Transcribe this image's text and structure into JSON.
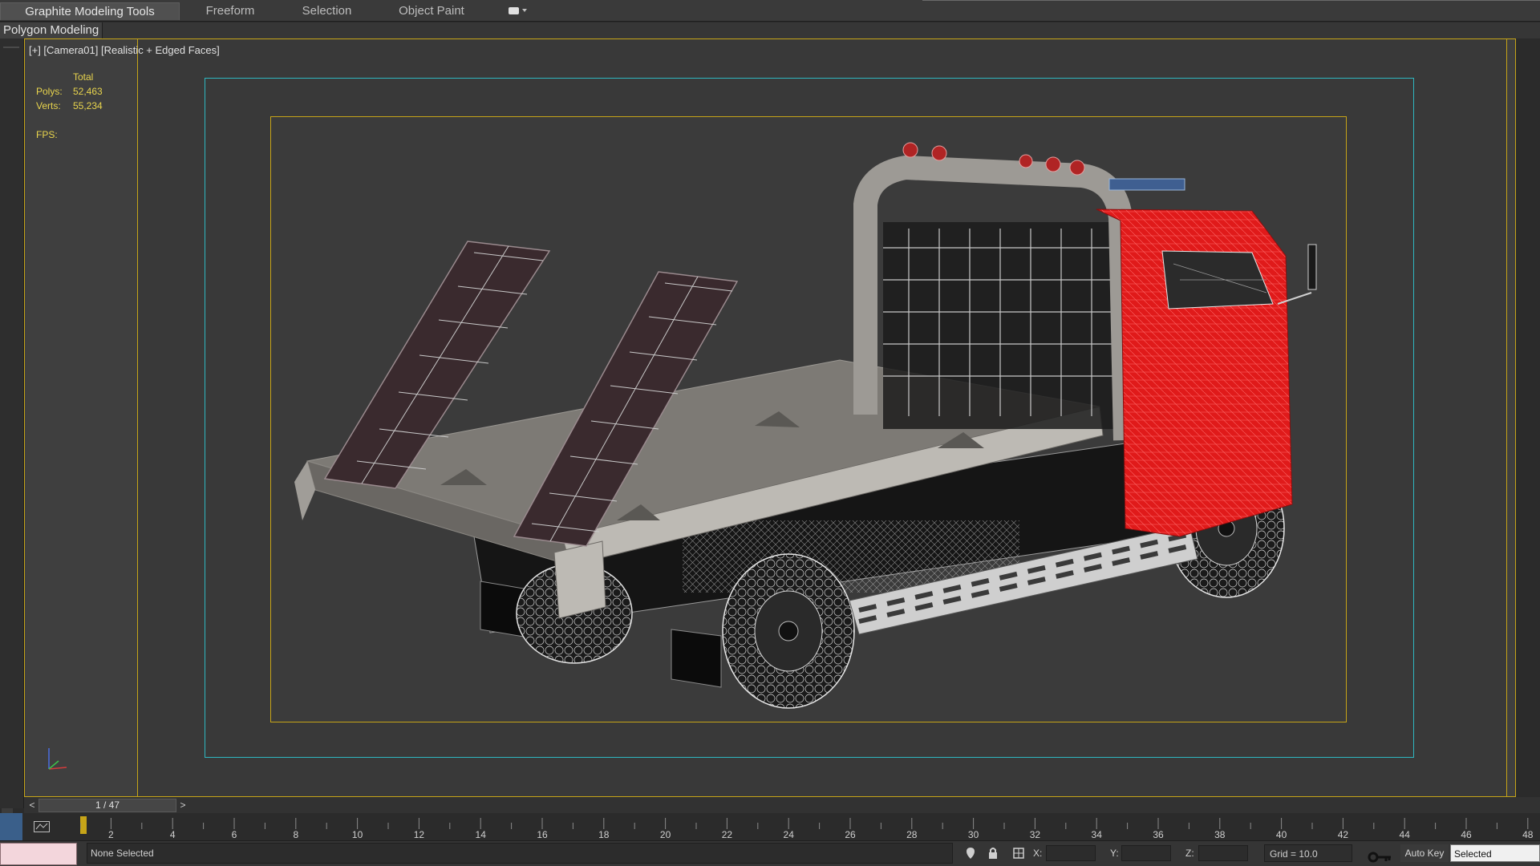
{
  "ribbon": {
    "tabs": [
      {
        "label": "Graphite Modeling Tools",
        "active": true
      },
      {
        "label": "Freeform",
        "active": false
      },
      {
        "label": "Selection",
        "active": false
      },
      {
        "label": "Object Paint",
        "active": false
      }
    ],
    "dropdown_icon": "display-options-icon"
  },
  "panel": {
    "label": "Polygon Modeling"
  },
  "viewport": {
    "label": "[+] [Camera01] [Realistic + Edged Faces]",
    "stats": {
      "header": "Total",
      "polys_label": "Polys:",
      "polys_value": "52,463",
      "verts_label": "Verts:",
      "verts_value": "55,234",
      "fps_label": "FPS:"
    },
    "frame_colors": {
      "safe": "#c6a418",
      "render": "#2fb7c1"
    },
    "truck_accent": "#e01a1a"
  },
  "time_slider": {
    "frame": "1 / 47",
    "prev": "<",
    "next": ">"
  },
  "timeline": {
    "ticks": [
      "2",
      "4",
      "6",
      "8",
      "10",
      "12",
      "14",
      "16",
      "18",
      "20",
      "22",
      "24",
      "26",
      "28",
      "30",
      "32",
      "34",
      "36",
      "38",
      "40",
      "42",
      "44",
      "46",
      "48"
    ]
  },
  "status": {
    "selection": "None Selected",
    "x_label": "X:",
    "y_label": "Y:",
    "z_label": "Z:",
    "grid": "Grid = 10.0",
    "auto_key": "Auto Key",
    "key_filter": "Selected"
  }
}
